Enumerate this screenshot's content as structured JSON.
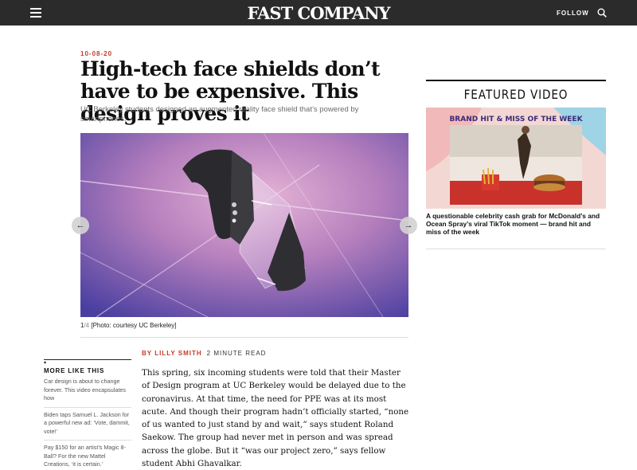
{
  "topbar": {
    "logo": "FAST COMPANY",
    "follow_label": "FOLLOW",
    "menu_icon": "hamburger-menu-icon",
    "search_icon": "search-icon"
  },
  "article": {
    "date": "10-08-20",
    "headline": "High-tech face shields don’t have to be expensive. This design proves it",
    "dek": "UC Berkeley students designed an augmented reality face shield that’s powered by smartphones.",
    "slide_current": "1",
    "slide_total": "/4",
    "photo_credit": "[Photo: courtesy UC Berkeley]",
    "byline": "BY LILLY SMITH",
    "read_time": "2 MINUTE READ",
    "body": "This spring, six incoming students were told that their Master of Design program at UC Berkeley would be delayed due to the coronavirus. At that time, the need for PPE was at its most acute. And though their program hadn’t officially started, “none of us wanted to just stand by and wait,” says student Roland Saekow. The group had never met in person and was spread across the globe. But it “was our project zero,” says fellow student Abhi Ghavalkar.",
    "prev_arrow": "←",
    "next_arrow": "→"
  },
  "more_like_this": {
    "title": "MORE LIKE THIS",
    "caret": "▾",
    "items": [
      "Car design is about to change forever. This video encapsulates how",
      "Biden taps Samuel L. Jackson for a powerful new ad: ‘Vote, dammit, vote!’",
      "Pay $150 for an artist’s Magic 8-Ball? For the new Mattel Creations, ‘it is certain.’"
    ]
  },
  "featured_video": {
    "title": "FEATURED VIDEO",
    "thumb_banner": "BRAND HIT & MISS OF THE WEEK",
    "caption": "A questionable celebrity cash grab for McDonald’s and Ocean Spray’s viral TikTok moment — brand hit and miss of the week"
  },
  "colors": {
    "accent_red": "#c33b2a",
    "topbar_bg": "#2b2b2b"
  }
}
